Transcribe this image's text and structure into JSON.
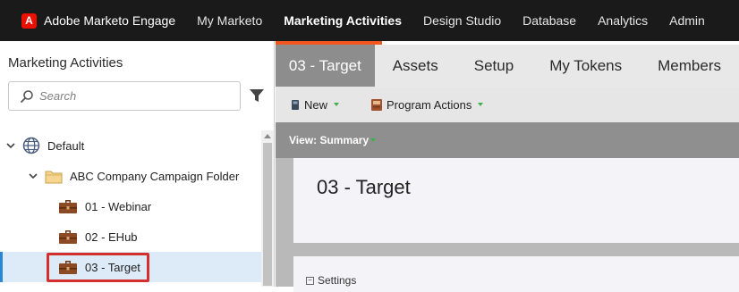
{
  "topnav": {
    "brand": "Adobe Marketo Engage",
    "items": [
      "My Marketo",
      "Marketing Activities",
      "Design Studio",
      "Database",
      "Analytics",
      "Admin"
    ],
    "active_index": 1
  },
  "left_panel": {
    "title": "Marketing Activities",
    "search_placeholder": "Search",
    "tree": [
      {
        "label": "Default",
        "icon": "globe-icon",
        "expanded": true
      },
      {
        "label": "ABC Company Campaign Folder",
        "icon": "folder-icon",
        "expanded": true
      },
      {
        "label": "01 - Webinar",
        "icon": "briefcase-icon"
      },
      {
        "label": "02 - EHub",
        "icon": "briefcase-icon"
      },
      {
        "label": "03 - Target",
        "icon": "briefcase-icon",
        "selected": true
      }
    ]
  },
  "tabs": [
    "03 - Target",
    "Assets",
    "Setup",
    "My Tokens",
    "Members"
  ],
  "toolbar": {
    "new_label": "New",
    "program_actions_label": "Program Actions"
  },
  "view_label": "View: Summary",
  "card": {
    "title": "03 - Target",
    "settings_label": "Settings"
  },
  "colors": {
    "accent_orange": "#f0581f",
    "selection_blue": "#2b87d3",
    "highlight_red": "#d32f2f",
    "brand_red": "#eb1000"
  }
}
